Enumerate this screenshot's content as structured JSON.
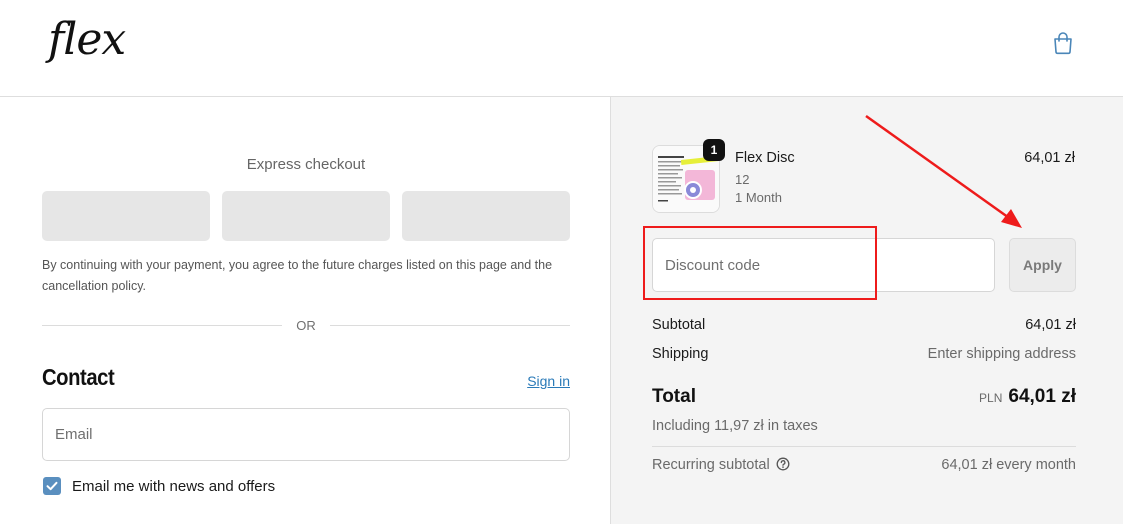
{
  "header": {
    "logo_text": "flex",
    "cart_icon": "shopping-bag-icon"
  },
  "express": {
    "title": "Express checkout",
    "legal_text": "By continuing with your payment, you agree to the future charges listed on this page and the cancellation policy.",
    "or_text": "OR"
  },
  "contact": {
    "title": "Contact",
    "signin_label": "Sign in",
    "email_placeholder": "Email",
    "newsletter_label": "Email me with news and offers",
    "newsletter_checked": true
  },
  "summary": {
    "product": {
      "name": "Flex Disc",
      "quantity_badge": "1",
      "variant": "12",
      "plan": "1 Month",
      "price": "64,01 zł"
    },
    "discount": {
      "placeholder": "Discount code",
      "apply_label": "Apply"
    },
    "subtotal_label": "Subtotal",
    "subtotal_value": "64,01 zł",
    "shipping_label": "Shipping",
    "shipping_value": "Enter shipping address",
    "total_label": "Total",
    "currency": "PLN",
    "total_value": "64,01 zł",
    "taxes_text": "Including 11,97 zł in taxes",
    "recurring_label": "Recurring subtotal",
    "recurring_value": "64,01 zł every month"
  },
  "colors": {
    "accent": "#2a7ab8",
    "checkbox": "#5a8fbf",
    "annotation": "#ee1b1b",
    "summary_bg": "#f4f4f4"
  }
}
